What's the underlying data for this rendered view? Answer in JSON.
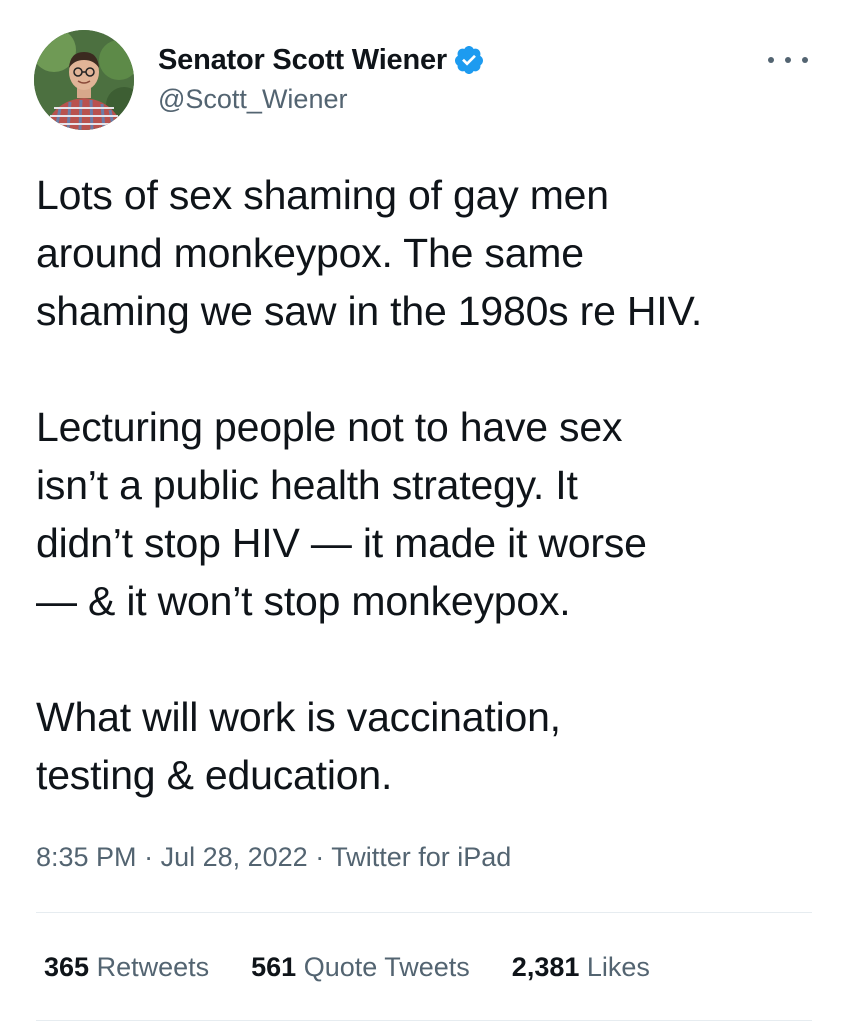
{
  "author": {
    "display_name": "Senator Scott Wiener",
    "handle": "@Scott_Wiener",
    "verified": true,
    "verified_color": "#1d9bf0"
  },
  "tweet": {
    "paragraphs": [
      "Lots of sex shaming of gay men\naround monkeypox. The same\nshaming we saw in the 1980s re HIV.",
      "Lecturing people not to have sex\nisn’t a public health strategy. It\ndidn’t stop HIV — it made it worse\n— & it won’t stop monkeypox.",
      "What will work is vaccination,\ntesting & education."
    ]
  },
  "meta": {
    "time": "8:35 PM",
    "date": "Jul 28, 2022",
    "source": "Twitter for iPad",
    "separator": " · "
  },
  "stats": {
    "retweets_count": "365",
    "retweets_label": " Retweets",
    "quotes_count": "561",
    "quotes_label": " Quote Tweets",
    "likes_count": "2,381",
    "likes_label": " Likes"
  }
}
